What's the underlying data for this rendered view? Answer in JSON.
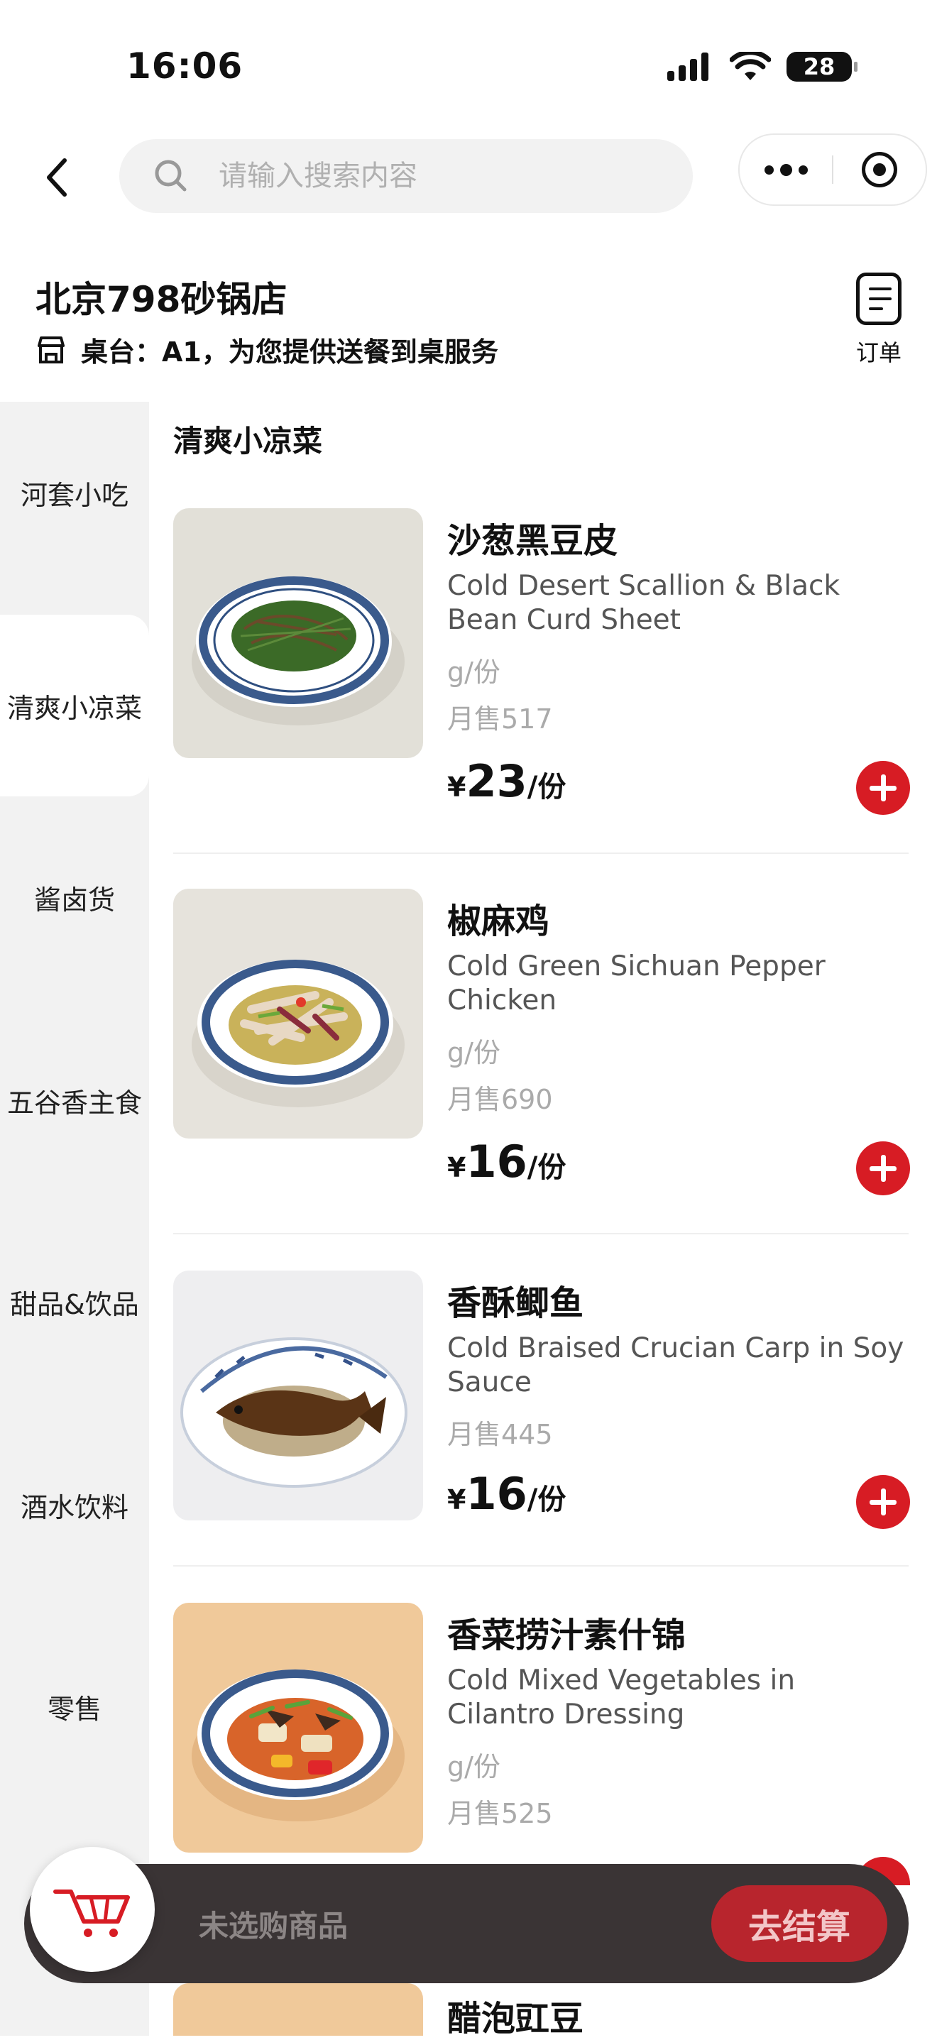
{
  "status_bar": {
    "time": "16:06",
    "battery": "28"
  },
  "search": {
    "placeholder": "请输入搜索内容"
  },
  "store": {
    "name": "北京798砂锅店",
    "table_info": "桌台：A1，为您提供送餐到桌服务",
    "order_label": "订单"
  },
  "sidebar": {
    "categories": [
      {
        "label": "河套小吃"
      },
      {
        "label": "清爽小凉菜",
        "active": true
      },
      {
        "label": "酱卤货"
      },
      {
        "label": "五谷香主食"
      },
      {
        "label": "甜品&饮品"
      },
      {
        "label": "酒水饮料"
      },
      {
        "label": "零售"
      }
    ]
  },
  "section": {
    "title": "清爽小凉菜"
  },
  "items": [
    {
      "name": "沙葱黑豆皮",
      "english": "Cold Desert Scallion & Black Bean Curd Sheet",
      "unit": "g/份",
      "sales": "月售517",
      "currency": "¥",
      "price": "23",
      "per": "/份"
    },
    {
      "name": "椒麻鸡",
      "english": "Cold Green Sichuan Pepper Chicken",
      "unit": "g/份",
      "sales": "月售690",
      "currency": "¥",
      "price": "16",
      "per": "/份"
    },
    {
      "name": "香酥鲫鱼",
      "english": "Cold Braised Crucian Carp in Soy Sauce",
      "sales": "月售445",
      "currency": "¥",
      "price": "16",
      "per": "/份"
    },
    {
      "name": "香菜捞汁素什锦",
      "english": "Cold Mixed Vegetables in Cilantro Dressing",
      "unit": "g/份",
      "sales": "月售525"
    },
    {
      "name": "醋泡豇豆"
    }
  ],
  "cart": {
    "empty_text": "未选购商品",
    "checkout_label": "去结算"
  },
  "colors": {
    "accent_red": "#d71c24",
    "cart_bar": "#3a3435",
    "sidebar_bg": "#f2f2f2"
  },
  "icons": [
    "back-chevron-icon",
    "search-icon",
    "more-dots-icon",
    "close-mini-program-icon",
    "shop-icon",
    "order-list-icon",
    "plus-icon",
    "cart-icon"
  ]
}
